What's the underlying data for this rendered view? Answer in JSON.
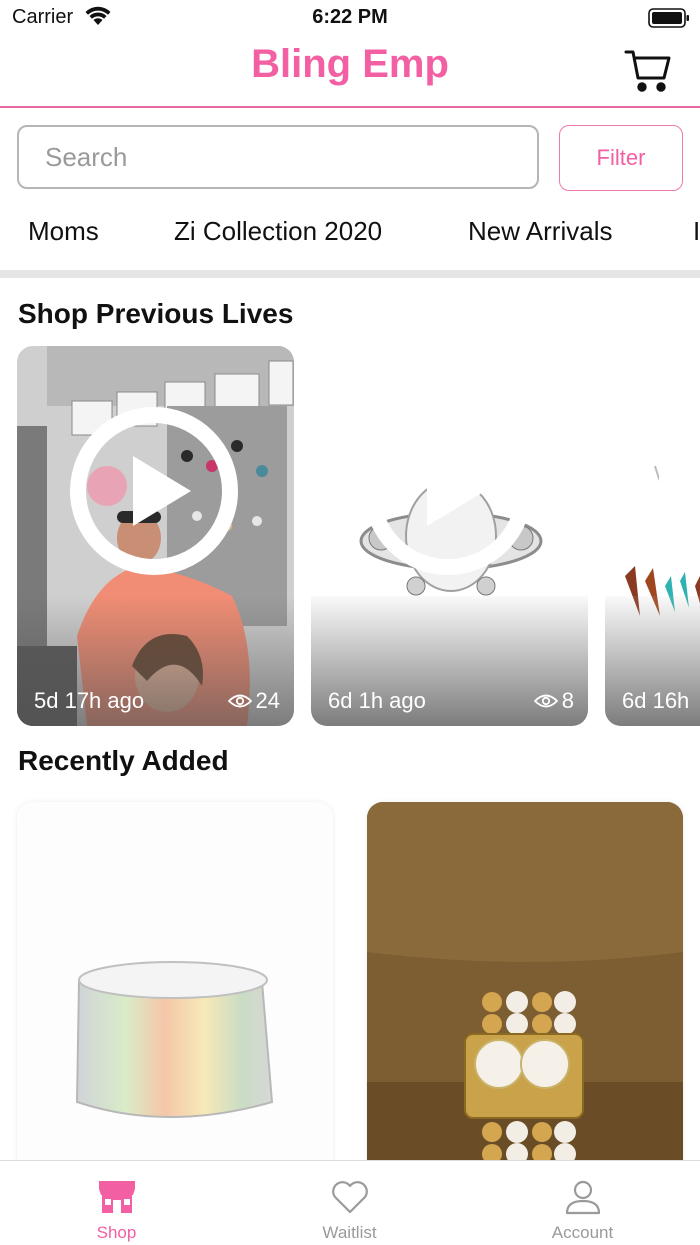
{
  "status_bar": {
    "carrier": "Carrier",
    "time": "6:22 PM"
  },
  "header": {
    "title": "Bling Emp",
    "title_color": "#f25fa2"
  },
  "search": {
    "placeholder": "Search",
    "value": ""
  },
  "filter": {
    "label": "Filter"
  },
  "categories": [
    "Moms",
    "Zi Collection 2020",
    "New Arrivals"
  ],
  "sections": {
    "previous_lives": "Shop Previous Lives",
    "recently_added": "Recently Added"
  },
  "lives": [
    {
      "time": "5d 17h ago",
      "views": "24"
    },
    {
      "time": "6d 1h ago",
      "views": "8"
    },
    {
      "time": "6d 16h"
    }
  ],
  "products": [
    {
      "image": "holographic-cuff-bracelet"
    },
    {
      "image": "pearl-gold-bead-bracelet"
    }
  ],
  "tabs": [
    {
      "label": "Shop",
      "icon": "store-icon",
      "active": true
    },
    {
      "label": "Waitlist",
      "icon": "heart-icon",
      "active": false
    },
    {
      "label": "Account",
      "icon": "person-icon",
      "active": false
    }
  ],
  "colors": {
    "accent": "#f25fa2",
    "divider": "#e6e6e6",
    "inactive": "#9a9a9a"
  }
}
